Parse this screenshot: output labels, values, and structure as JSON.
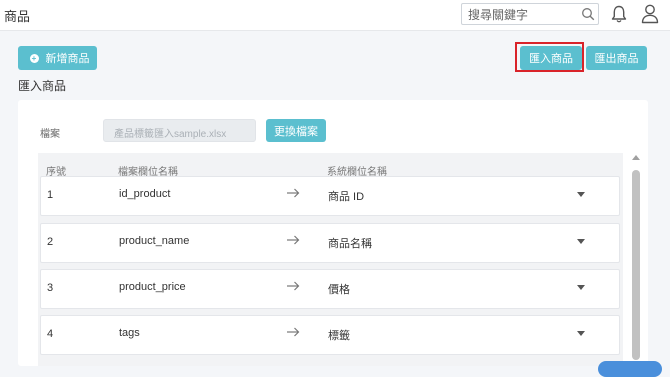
{
  "app": {
    "title": "商品"
  },
  "header": {
    "search_placeholder": "搜尋關鍵字",
    "icons": [
      "search-icon",
      "bell-icon",
      "user-icon"
    ]
  },
  "toolbar": {
    "add_label": "新增商品",
    "import_label": "匯入商品",
    "export_label": "匯出商品"
  },
  "section": {
    "title": "匯入商品"
  },
  "file": {
    "label": "檔案",
    "placeholder": "產品標籤匯入sample.xlsx",
    "change_label": "更換檔案"
  },
  "mapping": {
    "columns": {
      "no": "序號",
      "file_field": "檔案欄位名稱",
      "system_field": "系統欄位名稱"
    },
    "rows": [
      {
        "no": "1",
        "file_field": "id_product",
        "system_field": "商品 ID"
      },
      {
        "no": "2",
        "file_field": "product_name",
        "system_field": "商品名稱"
      },
      {
        "no": "3",
        "file_field": "product_price",
        "system_field": "價格"
      },
      {
        "no": "4",
        "file_field": "tags",
        "system_field": "標籤"
      }
    ]
  },
  "colors": {
    "accent": "#5bbfcf",
    "highlight": "#d9232a",
    "background": "#f4f6f9"
  }
}
